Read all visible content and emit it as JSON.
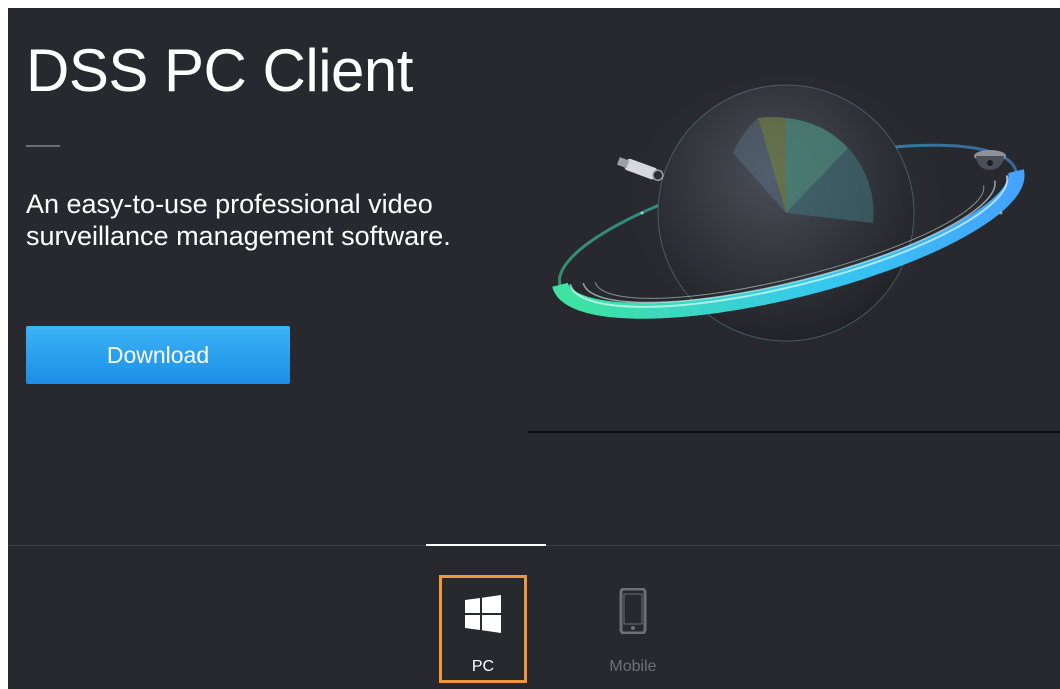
{
  "hero": {
    "title": "DSS PC Client",
    "description": "An easy-to-use professional video surveillance management software.",
    "download_label": "Download",
    "accent_color": "#2aa3ee"
  },
  "tabs": [
    {
      "label": "PC",
      "icon": "windows-icon",
      "selected": true
    },
    {
      "label": "Mobile",
      "icon": "mobile-phone-icon",
      "selected": false
    }
  ],
  "colors": {
    "background": "#27292e",
    "selection_border": "#f09837",
    "ring_gradient": [
      "#3fe3a0",
      "#35c8ef",
      "#46a2ff"
    ]
  }
}
